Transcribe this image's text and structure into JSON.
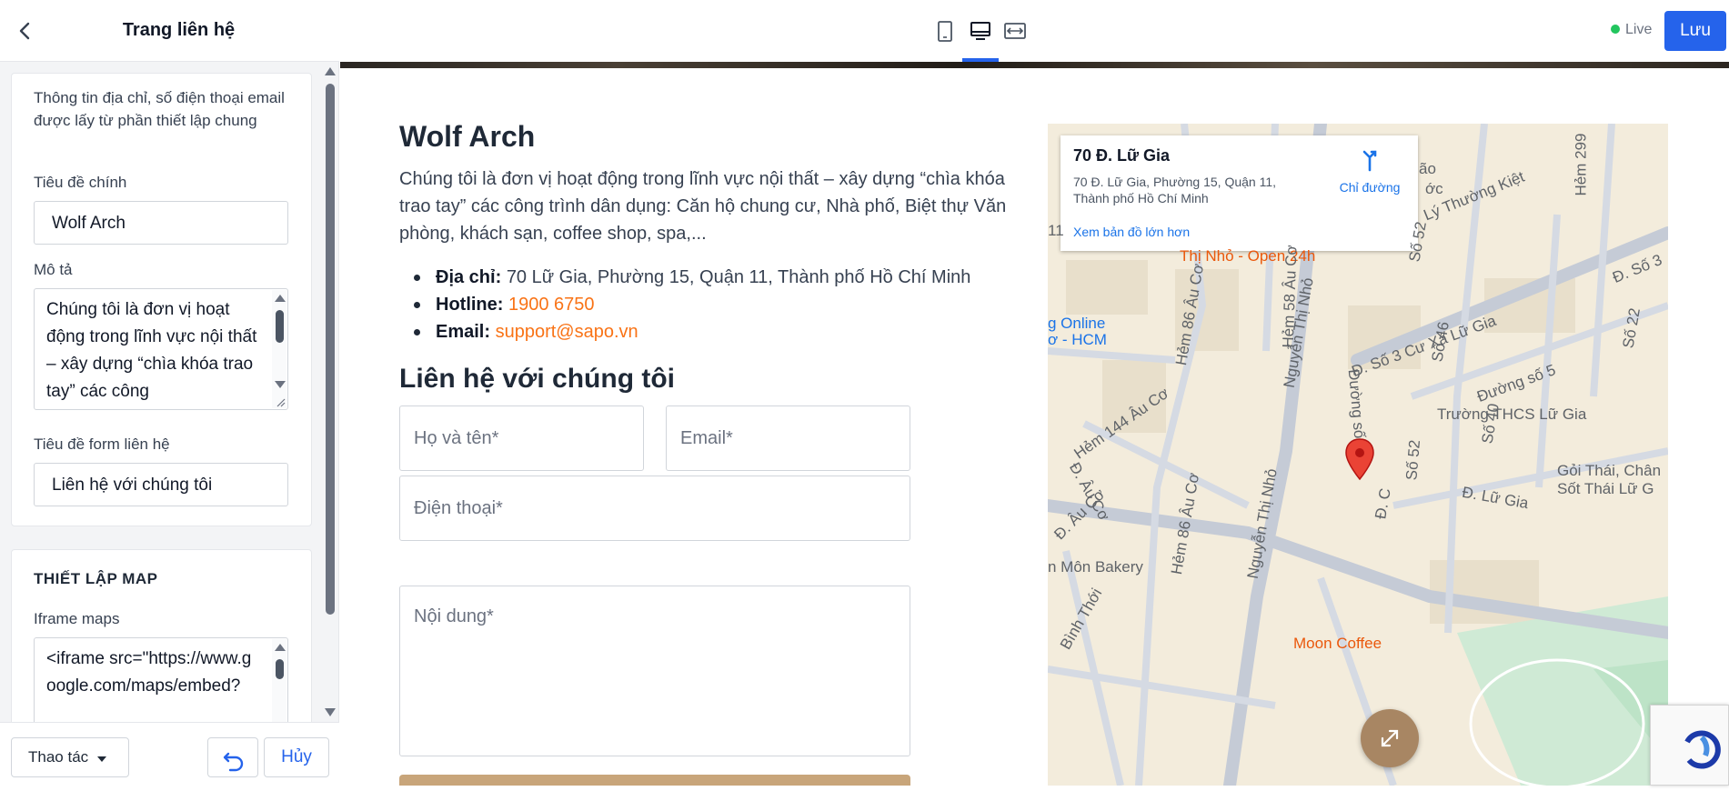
{
  "sidebar": {
    "title": "Trang liên hệ",
    "info_note": "Thông tin địa chỉ, số điện thoại email được lấy từ phần thiết lập chung",
    "main_title_label": "Tiêu đề chính",
    "main_title_value": "Wolf Arch",
    "description_label": "Mô tả",
    "description_value": "Chúng tôi là đơn vị hoạt động trong lĩnh vực nội thất – xây dựng “chìa khóa trao tay” các công",
    "form_title_label": "Tiêu đề form liên hệ",
    "form_title_value": "Liên hệ với chúng tôi",
    "map_section_title": "THIẾT LẬP MAP",
    "iframe_label": "Iframe maps",
    "iframe_value": "<iframe src=\"https://www.google.com/maps/embed?",
    "actions_label": "Thao tác",
    "cancel_label": "Hủy"
  },
  "topbar": {
    "live_label": "Live",
    "save_label": "Lưu",
    "active_device": "desktop"
  },
  "preview": {
    "title": "Wolf Arch",
    "description": "Chúng tôi là đơn vị hoạt động trong lĩnh vực nội thất – xây dựng “chìa khóa trao tay” các công trình dân dụng: Căn hộ chung cư, Nhà phố, Biệt thự Văn phòng, khách sạn, coffee shop, spa,...",
    "address_label": "Địa chỉ:",
    "address_value": "70 Lữ Gia, Phường 15, Quận 11, Thành phố Hồ Chí Minh",
    "hotline_label": "Hotline:",
    "hotline_value": "1900 6750",
    "email_label": "Email:",
    "email_value": "support@sapo.vn",
    "form_heading": "Liên hệ với chúng tôi",
    "name_placeholder": "Họ và tên*",
    "email_placeholder": "Email*",
    "phone_placeholder": "Điện thoại*",
    "content_placeholder": "Nội dung*",
    "accent_color": "#f97316"
  },
  "map": {
    "place_name": "70 Đ. Lữ Gia",
    "place_address": "70 Đ. Lữ Gia, Phường 15, Quận 11, Thành phố Hồ Chí Minh",
    "directions_label": "Chỉ đường",
    "larger_map_label": "Xem bản đồ lớn hơn",
    "labels": {
      "l1": "Thị Nhỏ - Open 24h",
      "l2": "Lý Thường Kiệt",
      "l3": "Số 52",
      "l4": "Đ. Số 3",
      "l5": "Số 22",
      "l6": "Hẻm 299",
      "l7": "ớc",
      "l8": "ão",
      "l9": "g Online",
      "l10": "ơ - HCM",
      "l11": "Hẻm 86 Âu Cơ",
      "l12": "Hẻm 58 Âu Cơ",
      "l13": "Nguyễn Thị Nhỏ",
      "l14": "Đ. Số 3 Cư Xá Lữ Gia",
      "l15": "Số 46",
      "l16": "Đường số 5",
      "l17": "Trường THCS Lữ Gia",
      "l18": "Số 40",
      "l19": "Hẻm 144 Âu Cơ",
      "l20": "Đường số 66",
      "l21": "Số 52",
      "l22": "Gỏi Thái, Chân",
      "l23": "Sốt Thái Lữ G",
      "l24": "Đ. Âu Cơ",
      "l25": "Hẻm 86 Âu Cơ",
      "l26": "Đ. Âu Cơ",
      "l27": "Đ. C",
      "l28": "Đ. Lữ Gia",
      "l29": "Nguyễn Thị Nhỏ",
      "l30": "n Môn Bakery",
      "l31": "Bình Thới",
      "l32": "Moon Coffee",
      "l33": "11"
    }
  }
}
